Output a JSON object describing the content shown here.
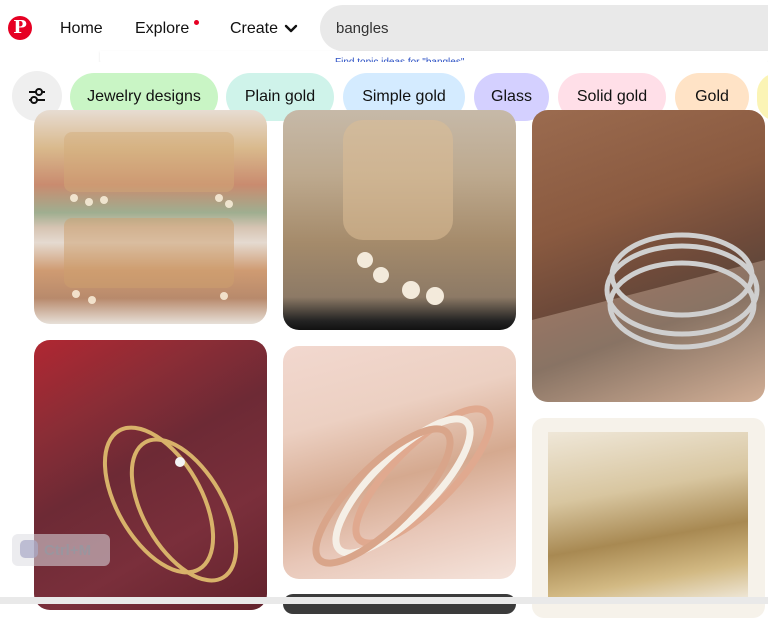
{
  "nav": {
    "logo_letter": "P",
    "home": "Home",
    "explore": "Explore",
    "create": "Create"
  },
  "search": {
    "value": "bangles",
    "topic_link": "Find topic ideas for \"bangles\""
  },
  "filters": {
    "chips": [
      "Jewelry designs",
      "Plain gold",
      "Simple gold",
      "Glass",
      "Solid gold",
      "Gold",
      ""
    ]
  },
  "pins": [
    {
      "id": "pin-layered-bangle-stacks-pastel"
    },
    {
      "id": "pin-gold-bangles-tassels"
    },
    {
      "id": "pin-oxidised-silver-bangles-wrist"
    },
    {
      "id": "pin-gold-bangles-diamond-red-cloth"
    },
    {
      "id": "pin-pink-white-bangle-set-flowers"
    },
    {
      "id": "pin-dark-partial"
    },
    {
      "id": "pin-pearl-gold-bangles"
    }
  ],
  "shortcut_overlay": {
    "text": "Ctrl+M"
  },
  "colors": {
    "brand": "#e60023",
    "search_bg": "#e9e9e9",
    "link": "#2b50c4"
  }
}
